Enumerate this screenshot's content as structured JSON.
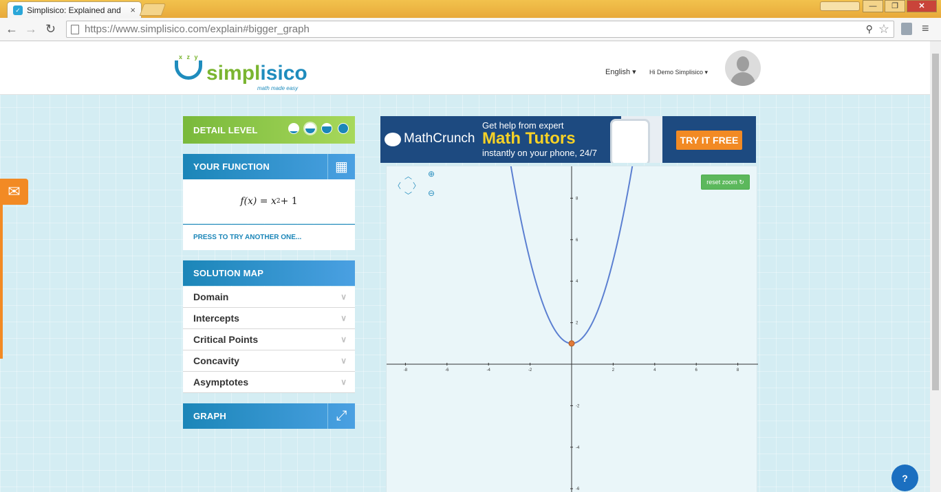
{
  "browser": {
    "tab_title": "Simplisico: Explained and",
    "tab_close": "×",
    "url_scheme_host": "https://www.simplisico.com",
    "url_path": "/explain#bigger_graph"
  },
  "header": {
    "logo_letters": "x z y",
    "logo_brand_prefix": "simpl",
    "logo_brand_suffix": "isico",
    "logo_tagline": "math made easy",
    "language": "English",
    "user_greeting": "Hi Demo Simplisico"
  },
  "sidebar": {
    "detail_level": {
      "label": "DETAIL LEVEL",
      "levels": [
        0.25,
        0.5,
        0.75,
        1.0
      ],
      "selected_index": 1
    },
    "your_function": {
      "label": "YOUR FUNCTION",
      "expression_prefix": "f(x) = x",
      "expression_exponent": "2",
      "expression_suffix": " + 1",
      "try_another": "PRESS TO TRY ANOTHER ONE..."
    },
    "solution_map": {
      "label": "SOLUTION MAP",
      "items": [
        "Domain",
        "Intercepts",
        "Critical Points",
        "Concavity",
        "Asymptotes"
      ]
    },
    "graph": {
      "label": "GRAPH"
    }
  },
  "ad": {
    "brand": "MathCrunch",
    "line1": "Get help from expert",
    "line2": "Math Tutors",
    "line3": "instantly on your phone, 24/7",
    "cta": "TRY IT FREE"
  },
  "graph": {
    "reset_zoom_label": "reset zoom",
    "x_ticks": [
      "-8",
      "-6",
      "-4",
      "-2",
      "2",
      "4",
      "6",
      "8"
    ],
    "y_ticks": [
      "8",
      "6",
      "4",
      "2",
      "-2",
      "-4",
      "-6"
    ],
    "highlighted_point": {
      "x": 0,
      "y": 1
    }
  },
  "colors": {
    "accent_blue": "#1b86b8",
    "accent_green": "#79b93b",
    "accent_orange": "#f28a24",
    "curve": "#5b7fd1"
  }
}
